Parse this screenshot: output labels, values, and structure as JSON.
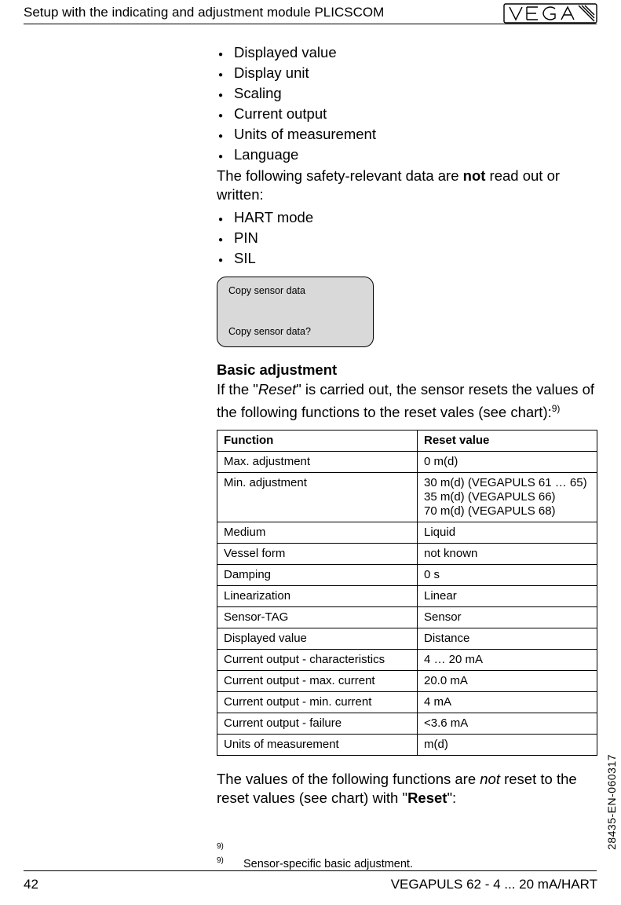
{
  "header": {
    "title": "Setup with the indicating and adjustment module PLICSCOM",
    "logo_text": "VEGA"
  },
  "list1": [
    "Displayed value",
    "Display unit",
    "Scaling",
    "Current output",
    "Units of measurement",
    "Language"
  ],
  "para1_a": "The following safety-relevant data are ",
  "para1_b": "not",
  "para1_c": " read out or written:",
  "list2": [
    "HART mode",
    "PIN",
    "SIL"
  ],
  "lcd": {
    "line1": "Copy sensor data",
    "line2": "Copy sensor data?"
  },
  "sub_heading": "Basic adjustment",
  "para2_a": "If the \"",
  "para2_b": "Reset",
  "para2_c": "\" is carried out, the sensor resets the values of the following functions to the reset vales (see chart):",
  "para2_ref": "9)",
  "table_head": {
    "c1": "Function",
    "c2": "Reset value"
  },
  "table_rows": [
    {
      "c1": "Max. adjustment",
      "c2": "0 m(d)"
    },
    {
      "c1": "Min. adjustment",
      "c2": "30 m(d) (VEGAPULS 61 … 65)\n35 m(d) (VEGAPULS 66)\n70 m(d) (VEGAPULS 68)"
    },
    {
      "c1": "Medium",
      "c2": "Liquid"
    },
    {
      "c1": "Vessel form",
      "c2": "not known"
    },
    {
      "c1": "Damping",
      "c2": "0 s"
    },
    {
      "c1": "Linearization",
      "c2": "Linear"
    },
    {
      "c1": "Sensor-TAG",
      "c2": "Sensor"
    },
    {
      "c1": "Displayed value",
      "c2": "Distance"
    },
    {
      "c1": "Current output - characteristics",
      "c2": "4 … 20 mA"
    },
    {
      "c1": "Current output - max. current",
      "c2": "20.0 mA"
    },
    {
      "c1": "Current output - min. current",
      "c2": "4 mA"
    },
    {
      "c1": "Current output - failure",
      "c2": "<3.6 mA"
    },
    {
      "c1": "Units of measurement",
      "c2": "m(d)"
    }
  ],
  "para3_a": "The values of the following functions are ",
  "para3_b": "not",
  "para3_c": " reset to the reset values (see chart) with \"",
  "para3_d": "Reset",
  "para3_e": "\":",
  "footnotes": {
    "mark1": "9)",
    "mark2": "9)",
    "text2": "Sensor-specific basic adjustment."
  },
  "footer": {
    "page": "42",
    "right": "VEGAPULS 62 - 4 ... 20 mA/HART",
    "sidecode": "28435-EN-060317"
  }
}
